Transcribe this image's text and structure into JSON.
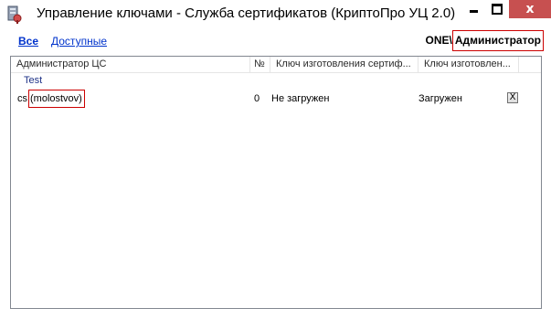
{
  "window": {
    "title": "Управление ключами - Служба сертификатов (КриптоПро УЦ 2.0)",
    "controls": {
      "minimize_icon": "minimize-icon",
      "maximize_icon": "maximize-icon",
      "close_glyph": "x"
    },
    "close_color": "#c75050"
  },
  "filter": {
    "all": "Все",
    "available": "Доступные"
  },
  "user": {
    "domain": "ONE\\",
    "name": "Администратор"
  },
  "list": {
    "columns": [
      "Администратор ЦС",
      "№",
      "Ключ изготовления сертиф...",
      "Ключ изготовлен..."
    ],
    "group": "Test",
    "rows": [
      {
        "prefix": "cs",
        "name": "(molostvov)",
        "number": "0",
        "manufacture_key": "Не загружен",
        "key_status": "Загружен",
        "delete_label": "X"
      }
    ]
  },
  "colors": {
    "link": "#0033cc",
    "group": "#1e3287",
    "highlight_border": "#cc0000"
  }
}
